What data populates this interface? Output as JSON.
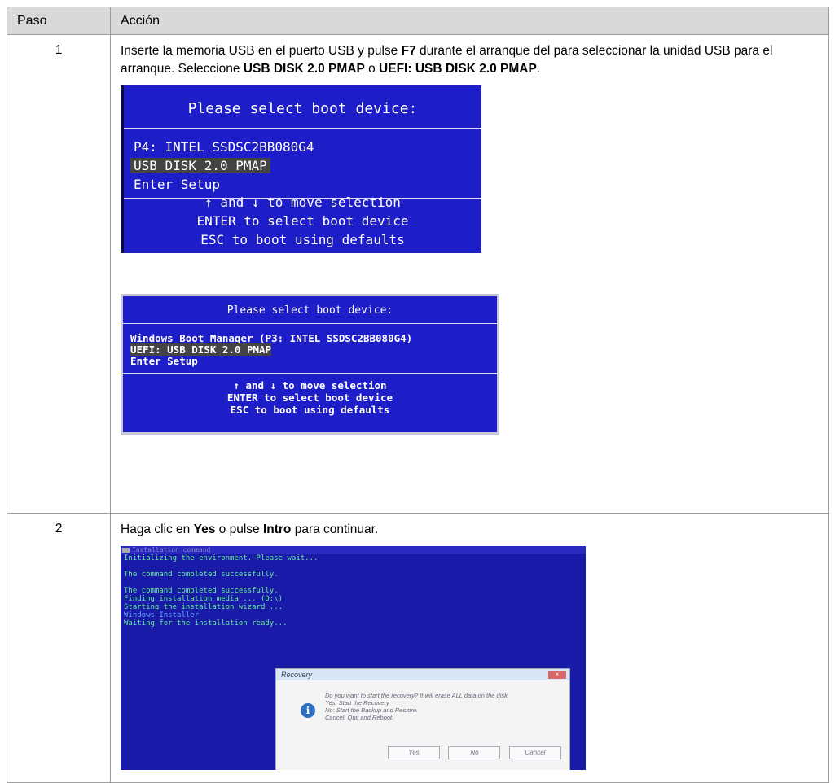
{
  "headers": {
    "step": "Paso",
    "action": "Acción"
  },
  "step1": {
    "number": "1",
    "text1": "Inserte la memoria USB en el puerto USB y pulse ",
    "key": "F7",
    "text2": " durante el arranque del para seleccionar la unidad USB para el arranque. Seleccione ",
    "opt1": "USB DISK 2.0 PMAP",
    "text3": " o ",
    "opt2": "UEFI: USB DISK 2.0 PMAP",
    "text4": ".",
    "bios1": {
      "title": "Please select boot device:",
      "options": [
        "P4: INTEL SSDSC2BB080G4",
        "USB DISK 2.0 PMAP",
        "Enter Setup"
      ],
      "help": [
        "↑ and ↓ to move selection",
        "ENTER to select boot device",
        "ESC to boot using defaults"
      ]
    },
    "bios2": {
      "title": "Please select boot device:",
      "options": [
        "Windows Boot Manager (P3: INTEL SSDSC2BB080G4)",
        "UEFI:  USB DISK 2.0 PMAP",
        "Enter Setup"
      ],
      "help": [
        "↑ and ↓ to move selection",
        "ENTER to select boot device",
        "ESC to boot using defaults"
      ]
    }
  },
  "step2": {
    "number": "2",
    "text1": "Haga clic en ",
    "yes": "Yes",
    "text2": " o pulse ",
    "key": "Intro",
    "text3": " para continuar.",
    "screen": {
      "bar_title": "Installation command",
      "lines": [
        "Initializing the environment. Please wait...",
        "",
        "The command completed successfully.",
        "",
        "The command completed successfully.",
        "Finding installation media ... (D:\\)",
        "Starting the installation wizard ...",
        "Windows Installer",
        "Waiting for the installation ready..."
      ],
      "dialog_title": "Recovery",
      "dialog_close": "×",
      "message": [
        "Do you want to start the recovery? It will erase ALL data on the disk.",
        "Yes: Start the Recovery.",
        "No: Start the Backup and Restore.",
        "Cancel: Quit and Reboot."
      ],
      "buttons": [
        "Yes",
        "No",
        "Cancel"
      ]
    }
  }
}
